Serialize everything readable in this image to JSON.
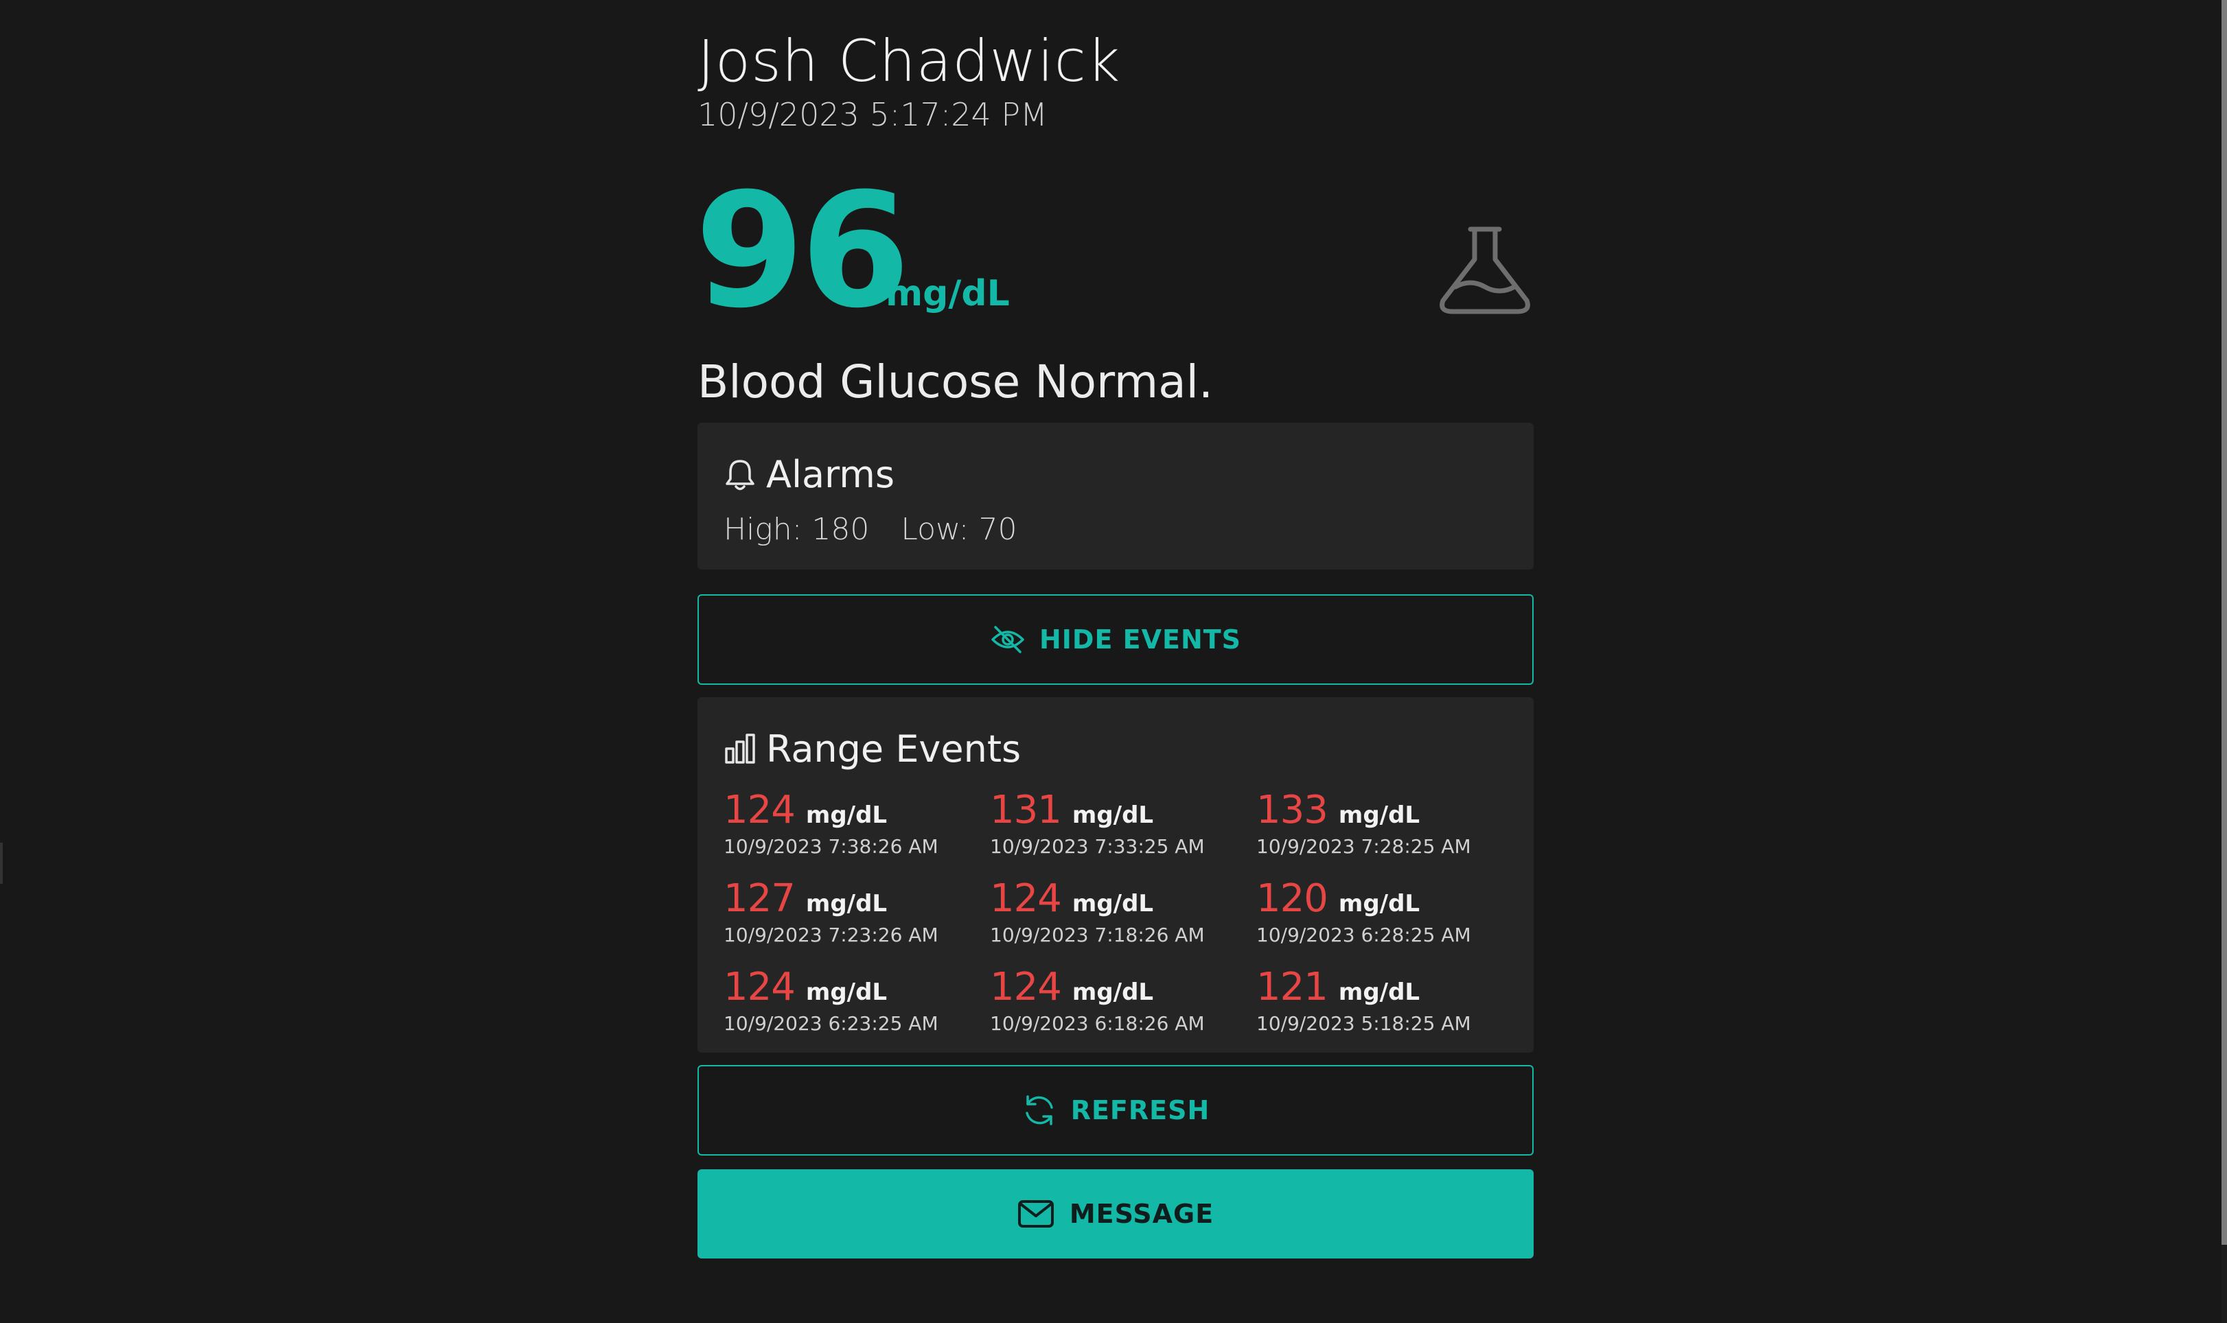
{
  "patient": {
    "name": "Josh Chadwick",
    "timestamp": "10/9/2023 5:17:24 PM"
  },
  "reading": {
    "value": "96",
    "unit": "mg/dL",
    "status": "Blood Glucose Normal.",
    "icon": "flask-icon"
  },
  "alarms": {
    "title": "Alarms",
    "icon": "bell-icon",
    "high_label": "High: 180",
    "low_label": "Low: 70"
  },
  "hide_events_button": {
    "label": "HIDE EVENTS",
    "icon": "eye-off-icon"
  },
  "range_events": {
    "title": "Range Events",
    "icon": "bar-chart-icon",
    "unit": "mg/dL",
    "events": [
      {
        "value": "124",
        "unit": "mg/dL",
        "time": "10/9/2023 7:38:26 AM"
      },
      {
        "value": "131",
        "unit": "mg/dL",
        "time": "10/9/2023 7:33:25 AM"
      },
      {
        "value": "133",
        "unit": "mg/dL",
        "time": "10/9/2023 7:28:25 AM"
      },
      {
        "value": "127",
        "unit": "mg/dL",
        "time": "10/9/2023 7:23:26 AM"
      },
      {
        "value": "124",
        "unit": "mg/dL",
        "time": "10/9/2023 7:18:26 AM"
      },
      {
        "value": "120",
        "unit": "mg/dL",
        "time": "10/9/2023 6:28:25 AM"
      },
      {
        "value": "124",
        "unit": "mg/dL",
        "time": "10/9/2023 6:23:25 AM"
      },
      {
        "value": "124",
        "unit": "mg/dL",
        "time": "10/9/2023 6:18:26 AM"
      },
      {
        "value": "121",
        "unit": "mg/dL",
        "time": "10/9/2023 5:18:25 AM"
      }
    ]
  },
  "refresh_button": {
    "label": "REFRESH",
    "icon": "refresh-icon"
  },
  "message_button": {
    "label": "MESSAGE",
    "icon": "envelope-icon"
  },
  "colors": {
    "background": "#181818",
    "card": "#252525",
    "accent": "#14b8a6",
    "out_of_range": "#e84545",
    "text": "#e6e6e6"
  }
}
